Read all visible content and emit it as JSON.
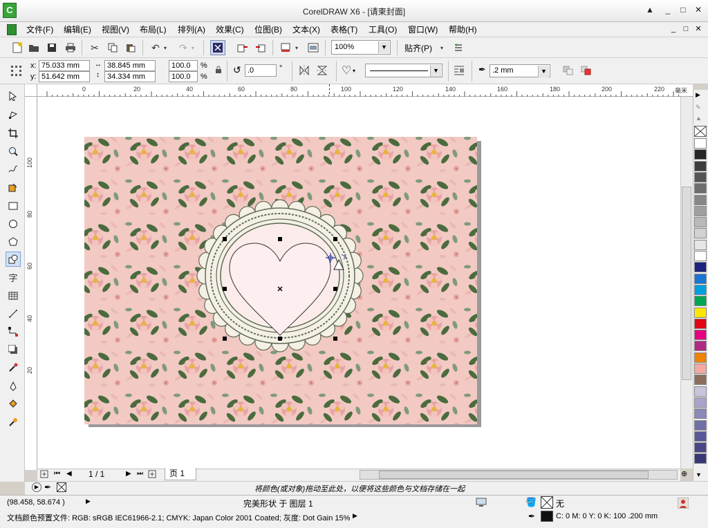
{
  "window": {
    "title": "CorelDRAW X6 - [请柬封面]",
    "controls": [
      "▲",
      "_",
      "□",
      "✕"
    ]
  },
  "menu": {
    "items": [
      "文件(F)",
      "编辑(E)",
      "视图(V)",
      "布局(L)",
      "排列(A)",
      "效果(C)",
      "位图(B)",
      "文本(X)",
      "表格(T)",
      "工具(O)",
      "窗口(W)",
      "帮助(H)"
    ],
    "mdi_controls": [
      "_",
      "□",
      "✕"
    ]
  },
  "toolbar": {
    "zoom": "100%",
    "snap_label": "贴齐(P)"
  },
  "propbar": {
    "x_label": "x:",
    "x_value": "75.033 mm",
    "y_label": "y:",
    "y_value": "51.642 mm",
    "w_value": "38.845 mm",
    "h_value": "34.334 mm",
    "scale_w": "100.0",
    "scale_h": "100.0",
    "percent": "%",
    "rotation": ".0",
    "degree": "°",
    "outline_width": ".2 mm"
  },
  "ruler": {
    "h_ticks": [
      "0",
      "20",
      "40",
      "60",
      "80",
      "100",
      "120",
      "140",
      "160",
      "180",
      "200",
      "220"
    ],
    "v_ticks": [
      "100",
      "80",
      "60",
      "40",
      "20"
    ],
    "unit": "毫米"
  },
  "pagenav": {
    "counter": "1 / 1",
    "tab": "页 1"
  },
  "hint": "将颜色(或对象)拖动至此处，以便将这些颜色与文档存储在一起",
  "status": {
    "coords": "(98.458, 58.674 )",
    "object_info": "完美形状 于 图层 1",
    "fill_label": "无",
    "color_profile": "文档颜色预置文件: RGB: sRGB IEC61966-2.1; CMYK: Japan Color 2001 Coated; 灰度: Dot Gain 15%",
    "outline_info": "C: 0 M: 0 Y: 0 K: 100  .200 mm"
  },
  "colors": {
    "page_bg": "#f2c9c3",
    "flower": "#e7a5a1",
    "leaf": "#4b6b3e",
    "heart_fill": "#fdeff0",
    "lace": "#f5f0e6",
    "lace_border": "#5f6b55",
    "palette": [
      "#ffffff",
      "#262626",
      "#3d3d3d",
      "#555555",
      "#6e6e6e",
      "#878787",
      "#a0a0a0",
      "#b9b9b9",
      "#d2d2d2",
      "#e6e6e6",
      "#ffffff",
      "#1a237e",
      "#1976d2",
      "#00a0e0",
      "#00a651",
      "#ffe600",
      "#e30613",
      "#e4007f",
      "#b02a83",
      "#ef8200",
      "#f4a9a0",
      "#8a6e5c",
      "#c8c4dc",
      "#a8a4cc",
      "#8c88b8",
      "#7070a8",
      "#585898",
      "#484888",
      "#383878"
    ]
  }
}
